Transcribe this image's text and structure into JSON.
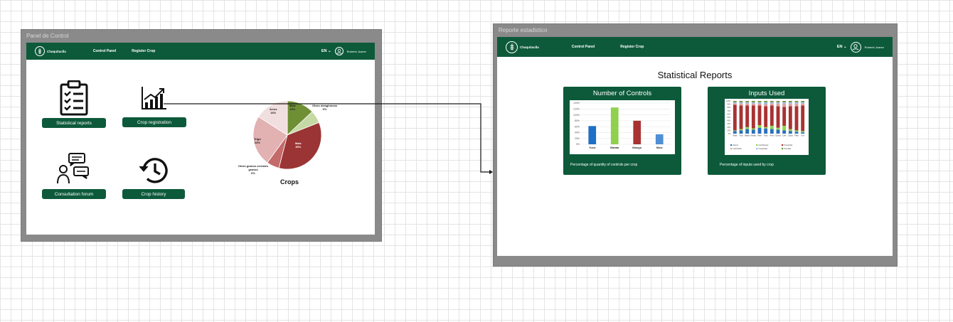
{
  "left_frame": {
    "label": "Panel de Control",
    "nav": {
      "brand": "Chaquitaclla",
      "links": [
        "Control Panel",
        "Register Crop"
      ],
      "lang": "EN",
      "user": "Roberto Juarez"
    },
    "tiles": [
      {
        "label": "Statistical reports",
        "icon": "clipboard-checklist-icon"
      },
      {
        "label": "Crop registration",
        "icon": "growth-chart-icon"
      },
      {
        "label": "Consultation forum",
        "icon": "chat-people-icon"
      },
      {
        "label": "Crop history",
        "icon": "history-clock-icon"
      }
    ],
    "pie": {
      "title": "Crops",
      "labels": [
        {
          "name": "Maíz",
          "pct": "13%"
        },
        {
          "name": "Otros oleaginosos",
          "pct": "6%"
        },
        {
          "name": "Maíz",
          "pct": "35%"
        },
        {
          "name": "Otros granos cereales granos",
          "pct": "6%"
        },
        {
          "name": "Trigo",
          "pct": "24%"
        },
        {
          "name": "Arroz",
          "pct": "16%"
        }
      ]
    }
  },
  "right_frame": {
    "label": "Reporte estadistico",
    "nav": {
      "brand": "Chaquitaclla",
      "links": [
        "Control Panel",
        "Register Crop"
      ],
      "lang": "EN",
      "user": "Roberto Juarez"
    },
    "title": "Statistical Reports",
    "card1": {
      "title": "Number of Controls",
      "caption": "Percentage of quantity of controls per crop"
    },
    "card2": {
      "title": "Inputs Used",
      "caption": "Percentage of inputs used by crop"
    }
  },
  "chart_data": [
    {
      "type": "pie",
      "title": "Crops",
      "slices": [
        {
          "label": "Maíz",
          "value": 13,
          "color": "#6f8f35"
        },
        {
          "label": "Otros oleaginosos",
          "value": 6,
          "color": "#c5d9a4"
        },
        {
          "label": "Maíz",
          "value": 35,
          "color": "#9b3434"
        },
        {
          "label": "Otros granos cereales granos",
          "value": 6,
          "color": "#c46a6a"
        },
        {
          "label": "Trigo",
          "value": 24,
          "color": "#e2b1b1"
        },
        {
          "label": "Arroz",
          "value": 16,
          "color": "#f1dede"
        }
      ]
    },
    {
      "type": "bar",
      "categories": [
        "Yuca",
        "Batata",
        "Mango",
        "Maíz"
      ],
      "values": [
        62,
        125,
        80,
        34
      ],
      "colors": [
        "#1f6fc5",
        "#8fd14f",
        "#a83232",
        "#4f8fd6"
      ],
      "ylim": [
        0,
        140
      ],
      "yticks": [
        "0%",
        "20%",
        "40%",
        "60%",
        "80%",
        "100%",
        "120%",
        "140%"
      ]
    },
    {
      "type": "bar",
      "stacked": true,
      "categories": [
        "Papa",
        "Yuca",
        "Batata",
        "Mango",
        "Maíz",
        "Trigo",
        "Arroz",
        "Quinua",
        "Café",
        "Cacao",
        "Palta",
        "Uva"
      ],
      "series_colors": [
        "#2a6fbf",
        "#8fd14f",
        "#a83232",
        "#e0a0a0",
        "#9bbce6",
        "#6a9a3a"
      ],
      "yticks": [
        "0%",
        "10%",
        "20%",
        "30%",
        "40%",
        "50%",
        "60%",
        "70%",
        "80%",
        "90%",
        "100%"
      ],
      "legend": [
        "Abono",
        "Fertilizantes",
        "Pesticidas",
        "Herbicidas",
        "Fungicidas",
        "Semillas"
      ]
    }
  ]
}
